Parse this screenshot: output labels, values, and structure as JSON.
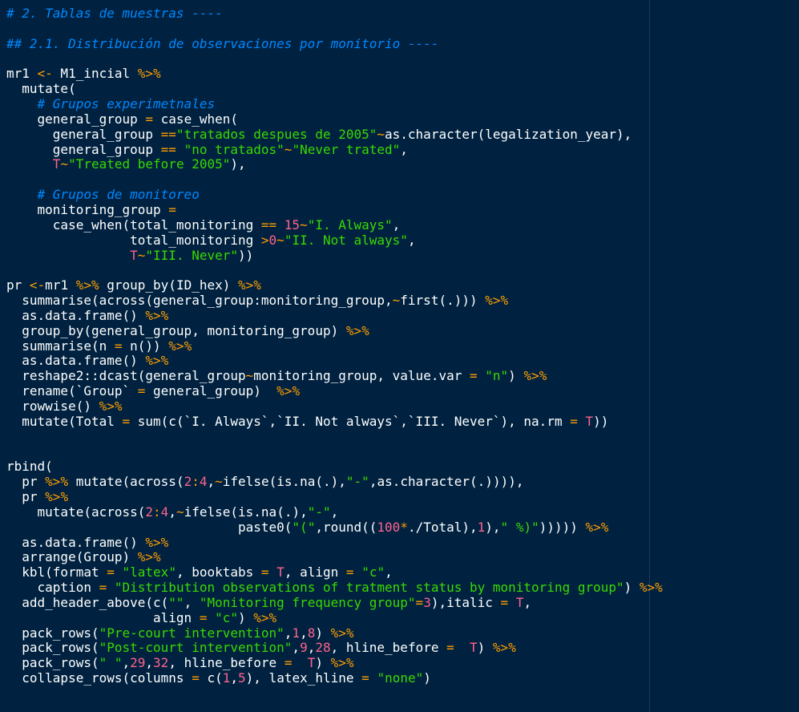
{
  "editor": {
    "background": "#002240",
    "colors": {
      "comment": "#0088ff",
      "string": "#3ad900",
      "number": "#ff628c",
      "operator": "#ff9d00",
      "identifier": "#ffffff"
    },
    "lines": [
      [
        {
          "t": "comment",
          "v": "# 2. Tablas de muestras ----"
        }
      ],
      [],
      [
        {
          "t": "comment",
          "v": "## 2.1. Distribución de observaciones por monitorio ----"
        }
      ],
      [],
      [
        {
          "t": "id",
          "v": "mr1 "
        },
        {
          "t": "op",
          "v": "<-"
        },
        {
          "t": "id",
          "v": " M1_incial "
        },
        {
          "t": "op",
          "v": "%>%"
        }
      ],
      [
        {
          "t": "id",
          "v": "  mutate("
        }
      ],
      [
        {
          "t": "comment",
          "v": "    # Grupos experimetnales"
        }
      ],
      [
        {
          "t": "id",
          "v": "    general_group "
        },
        {
          "t": "op",
          "v": "="
        },
        {
          "t": "id",
          "v": " case_when("
        }
      ],
      [
        {
          "t": "id",
          "v": "      general_group "
        },
        {
          "t": "op",
          "v": "=="
        },
        {
          "t": "string",
          "v": "\"tratados despues de 2005\""
        },
        {
          "t": "op",
          "v": "~"
        },
        {
          "t": "id",
          "v": "as.character(legalization_year),"
        }
      ],
      [
        {
          "t": "id",
          "v": "      general_group "
        },
        {
          "t": "op",
          "v": "=="
        },
        {
          "t": "id",
          "v": " "
        },
        {
          "t": "string",
          "v": "\"no tratados\""
        },
        {
          "t": "op",
          "v": "~"
        },
        {
          "t": "string",
          "v": "\"Never trated\""
        },
        {
          "t": "id",
          "v": ","
        }
      ],
      [
        {
          "t": "id",
          "v": "      "
        },
        {
          "t": "const",
          "v": "T"
        },
        {
          "t": "op",
          "v": "~"
        },
        {
          "t": "string",
          "v": "\"Treated before 2005\""
        },
        {
          "t": "id",
          "v": "),"
        }
      ],
      [],
      [
        {
          "t": "comment",
          "v": "    # Grupos de monitoreo"
        }
      ],
      [
        {
          "t": "id",
          "v": "    monitoring_group "
        },
        {
          "t": "op",
          "v": "="
        }
      ],
      [
        {
          "t": "id",
          "v": "      case_when(total_monitoring "
        },
        {
          "t": "op",
          "v": "=="
        },
        {
          "t": "id",
          "v": " "
        },
        {
          "t": "number",
          "v": "15"
        },
        {
          "t": "op",
          "v": "~"
        },
        {
          "t": "string",
          "v": "\"I. Always\""
        },
        {
          "t": "id",
          "v": ","
        }
      ],
      [
        {
          "t": "id",
          "v": "                total_monitoring "
        },
        {
          "t": "op",
          "v": ">"
        },
        {
          "t": "number",
          "v": "0"
        },
        {
          "t": "op",
          "v": "~"
        },
        {
          "t": "string",
          "v": "\"II. Not always\""
        },
        {
          "t": "id",
          "v": ","
        }
      ],
      [
        {
          "t": "id",
          "v": "                "
        },
        {
          "t": "const",
          "v": "T"
        },
        {
          "t": "op",
          "v": "~"
        },
        {
          "t": "string",
          "v": "\"III. Never\""
        },
        {
          "t": "id",
          "v": "))"
        }
      ],
      [],
      [
        {
          "t": "id",
          "v": "pr "
        },
        {
          "t": "op",
          "v": "<-"
        },
        {
          "t": "id",
          "v": "mr1 "
        },
        {
          "t": "op",
          "v": "%>%"
        },
        {
          "t": "id",
          "v": " group_by(ID_hex) "
        },
        {
          "t": "op",
          "v": "%>%"
        }
      ],
      [
        {
          "t": "id",
          "v": "  summarise(across(general_group:monitoring_group,"
        },
        {
          "t": "op",
          "v": "~"
        },
        {
          "t": "id",
          "v": "first(.))) "
        },
        {
          "t": "op",
          "v": "%>%"
        }
      ],
      [
        {
          "t": "id",
          "v": "  as.data.frame() "
        },
        {
          "t": "op",
          "v": "%>%"
        }
      ],
      [
        {
          "t": "id",
          "v": "  group_by(general_group, monitoring_group) "
        },
        {
          "t": "op",
          "v": "%>%"
        }
      ],
      [
        {
          "t": "id",
          "v": "  summarise(n "
        },
        {
          "t": "op",
          "v": "="
        },
        {
          "t": "id",
          "v": " n()) "
        },
        {
          "t": "op",
          "v": "%>%"
        }
      ],
      [
        {
          "t": "id",
          "v": "  as.data.frame() "
        },
        {
          "t": "op",
          "v": "%>%"
        }
      ],
      [
        {
          "t": "id",
          "v": "  reshape2::dcast(general_group"
        },
        {
          "t": "op",
          "v": "~"
        },
        {
          "t": "id",
          "v": "monitoring_group, value.var "
        },
        {
          "t": "op",
          "v": "="
        },
        {
          "t": "id",
          "v": " "
        },
        {
          "t": "string",
          "v": "\"n\""
        },
        {
          "t": "id",
          "v": ") "
        },
        {
          "t": "op",
          "v": "%>%"
        }
      ],
      [
        {
          "t": "id",
          "v": "  rename(`Group` "
        },
        {
          "t": "op",
          "v": "="
        },
        {
          "t": "id",
          "v": " general_group)  "
        },
        {
          "t": "op",
          "v": "%>%"
        }
      ],
      [
        {
          "t": "id",
          "v": "  rowwise() "
        },
        {
          "t": "op",
          "v": "%>%"
        }
      ],
      [
        {
          "t": "id",
          "v": "  mutate(Total "
        },
        {
          "t": "op",
          "v": "="
        },
        {
          "t": "id",
          "v": " sum(c(`I. Always`,`II. Not always`,`III. Never`), na.rm "
        },
        {
          "t": "op",
          "v": "="
        },
        {
          "t": "id",
          "v": " "
        },
        {
          "t": "const",
          "v": "T"
        },
        {
          "t": "id",
          "v": "))"
        }
      ],
      [],
      [],
      [
        {
          "t": "id",
          "v": "rbind("
        }
      ],
      [
        {
          "t": "id",
          "v": "  pr "
        },
        {
          "t": "op",
          "v": "%>%"
        },
        {
          "t": "id",
          "v": " mutate(across("
        },
        {
          "t": "number",
          "v": "2"
        },
        {
          "t": "op",
          "v": ":"
        },
        {
          "t": "number",
          "v": "4"
        },
        {
          "t": "id",
          "v": ","
        },
        {
          "t": "op",
          "v": "~"
        },
        {
          "t": "id",
          "v": "ifelse(is.na(.),"
        },
        {
          "t": "string",
          "v": "\"-\""
        },
        {
          "t": "id",
          "v": ",as.character(.)))),"
        }
      ],
      [
        {
          "t": "id",
          "v": "  pr "
        },
        {
          "t": "op",
          "v": "%>%"
        }
      ],
      [
        {
          "t": "id",
          "v": "    mutate(across("
        },
        {
          "t": "number",
          "v": "2"
        },
        {
          "t": "op",
          "v": ":"
        },
        {
          "t": "number",
          "v": "4"
        },
        {
          "t": "id",
          "v": ","
        },
        {
          "t": "op",
          "v": "~"
        },
        {
          "t": "id",
          "v": "ifelse(is.na(.),"
        },
        {
          "t": "string",
          "v": "\"-\""
        },
        {
          "t": "id",
          "v": ","
        }
      ],
      [
        {
          "t": "id",
          "v": "                              paste0("
        },
        {
          "t": "string",
          "v": "\"(\""
        },
        {
          "t": "id",
          "v": ",round(("
        },
        {
          "t": "number",
          "v": "100"
        },
        {
          "t": "op",
          "v": "*"
        },
        {
          "t": "id",
          "v": "./Total),"
        },
        {
          "t": "number",
          "v": "1"
        },
        {
          "t": "id",
          "v": "),"
        },
        {
          "t": "string",
          "v": "\" %)\""
        },
        {
          "t": "id",
          "v": "))))) "
        },
        {
          "t": "op",
          "v": "%>%"
        }
      ],
      [
        {
          "t": "id",
          "v": "  as.data.frame() "
        },
        {
          "t": "op",
          "v": "%>%"
        }
      ],
      [
        {
          "t": "id",
          "v": "  arrange(Group) "
        },
        {
          "t": "op",
          "v": "%>%"
        }
      ],
      [
        {
          "t": "id",
          "v": "  kbl(format "
        },
        {
          "t": "op",
          "v": "="
        },
        {
          "t": "id",
          "v": " "
        },
        {
          "t": "string",
          "v": "\"latex\""
        },
        {
          "t": "id",
          "v": ", booktabs "
        },
        {
          "t": "op",
          "v": "="
        },
        {
          "t": "id",
          "v": " "
        },
        {
          "t": "const",
          "v": "T"
        },
        {
          "t": "id",
          "v": ", align "
        },
        {
          "t": "op",
          "v": "="
        },
        {
          "t": "id",
          "v": " "
        },
        {
          "t": "string",
          "v": "\"c\""
        },
        {
          "t": "id",
          "v": ","
        }
      ],
      [
        {
          "t": "id",
          "v": "    caption "
        },
        {
          "t": "op",
          "v": "="
        },
        {
          "t": "id",
          "v": " "
        },
        {
          "t": "string",
          "v": "\"Distribution observations of tratment status by monitoring group\""
        },
        {
          "t": "id",
          "v": ") "
        },
        {
          "t": "op",
          "v": "%>%"
        }
      ],
      [
        {
          "t": "id",
          "v": "  add_header_above(c("
        },
        {
          "t": "string",
          "v": "\"\""
        },
        {
          "t": "id",
          "v": ", "
        },
        {
          "t": "string",
          "v": "\"Monitoring frequency group\""
        },
        {
          "t": "op",
          "v": "="
        },
        {
          "t": "number",
          "v": "3"
        },
        {
          "t": "id",
          "v": "),italic "
        },
        {
          "t": "op",
          "v": "="
        },
        {
          "t": "id",
          "v": " "
        },
        {
          "t": "const",
          "v": "T"
        },
        {
          "t": "id",
          "v": ","
        }
      ],
      [
        {
          "t": "id",
          "v": "                   align "
        },
        {
          "t": "op",
          "v": "="
        },
        {
          "t": "id",
          "v": " "
        },
        {
          "t": "string",
          "v": "\"c\""
        },
        {
          "t": "id",
          "v": ") "
        },
        {
          "t": "op",
          "v": "%>%"
        }
      ],
      [
        {
          "t": "id",
          "v": "  pack_rows("
        },
        {
          "t": "string",
          "v": "\"Pre-court intervention\""
        },
        {
          "t": "id",
          "v": ","
        },
        {
          "t": "number",
          "v": "1"
        },
        {
          "t": "id",
          "v": ","
        },
        {
          "t": "number",
          "v": "8"
        },
        {
          "t": "id",
          "v": ") "
        },
        {
          "t": "op",
          "v": "%>%"
        }
      ],
      [
        {
          "t": "id",
          "v": "  pack_rows("
        },
        {
          "t": "string",
          "v": "\"Post-court intervention\""
        },
        {
          "t": "id",
          "v": ","
        },
        {
          "t": "number",
          "v": "9"
        },
        {
          "t": "id",
          "v": ","
        },
        {
          "t": "number",
          "v": "28"
        },
        {
          "t": "id",
          "v": ", hline_before "
        },
        {
          "t": "op",
          "v": "="
        },
        {
          "t": "id",
          "v": "  "
        },
        {
          "t": "const",
          "v": "T"
        },
        {
          "t": "id",
          "v": ") "
        },
        {
          "t": "op",
          "v": "%>%"
        }
      ],
      [
        {
          "t": "id",
          "v": "  pack_rows("
        },
        {
          "t": "string",
          "v": "\" \""
        },
        {
          "t": "id",
          "v": ","
        },
        {
          "t": "number",
          "v": "29"
        },
        {
          "t": "id",
          "v": ","
        },
        {
          "t": "number",
          "v": "32"
        },
        {
          "t": "id",
          "v": ", hline_before "
        },
        {
          "t": "op",
          "v": "="
        },
        {
          "t": "id",
          "v": "  "
        },
        {
          "t": "const",
          "v": "T"
        },
        {
          "t": "id",
          "v": ") "
        },
        {
          "t": "op",
          "v": "%>%"
        }
      ],
      [
        {
          "t": "id",
          "v": "  collapse_rows(columns "
        },
        {
          "t": "op",
          "v": "="
        },
        {
          "t": "id",
          "v": " c("
        },
        {
          "t": "number",
          "v": "1"
        },
        {
          "t": "id",
          "v": ","
        },
        {
          "t": "number",
          "v": "5"
        },
        {
          "t": "id",
          "v": "), latex_hline "
        },
        {
          "t": "op",
          "v": "="
        },
        {
          "t": "id",
          "v": " "
        },
        {
          "t": "string",
          "v": "\"none\""
        },
        {
          "t": "id",
          "v": ")"
        }
      ]
    ]
  }
}
